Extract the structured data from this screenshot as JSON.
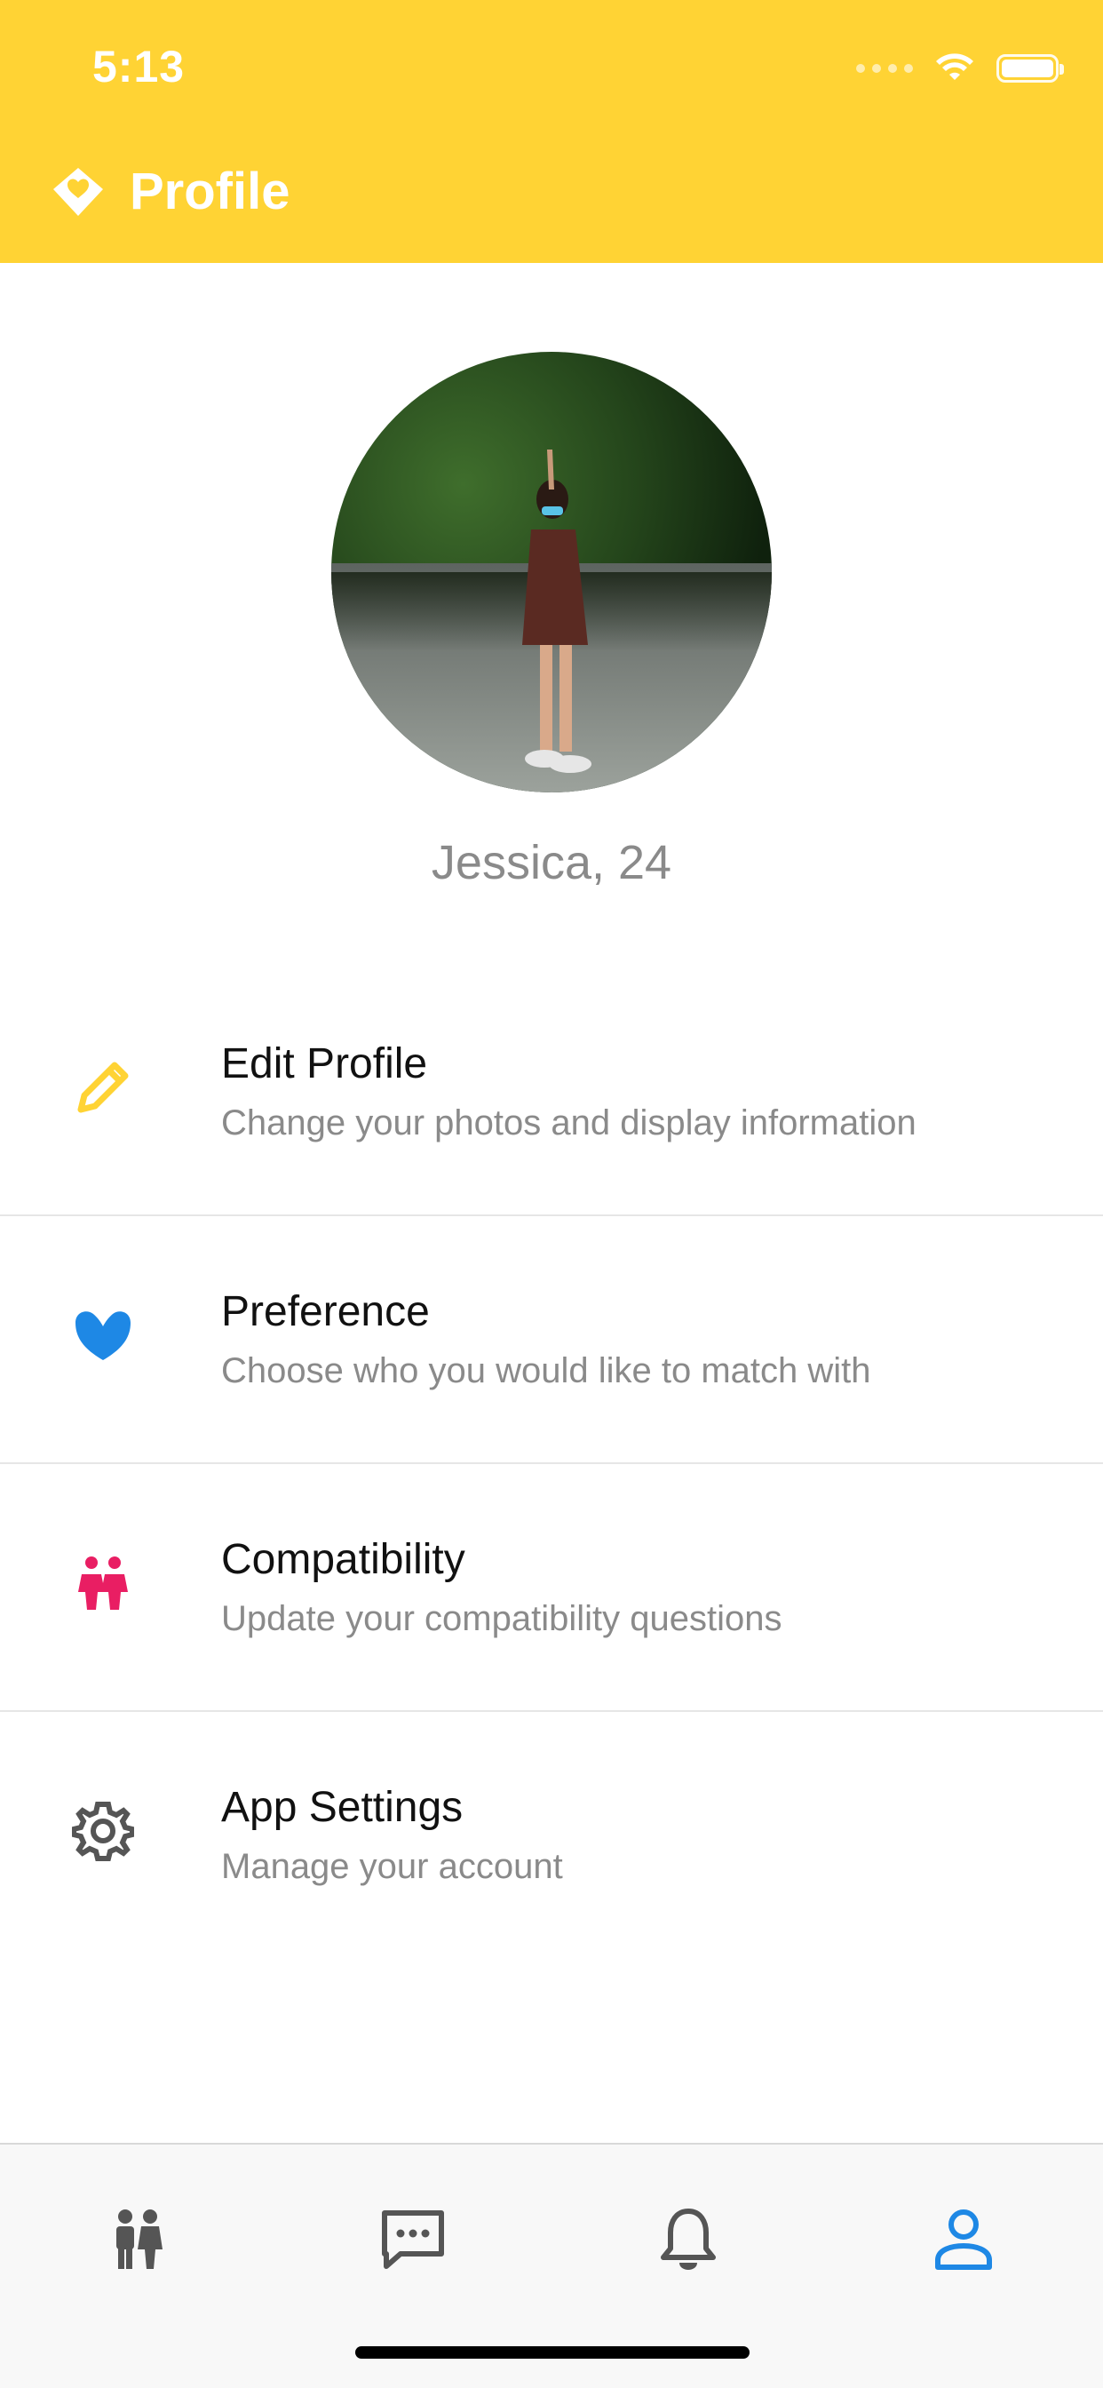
{
  "status_bar": {
    "time": "5:13"
  },
  "header": {
    "title": "Profile",
    "accent": "#FFD334"
  },
  "profile": {
    "name": "Jessica, 24"
  },
  "menu": [
    {
      "title": "Edit Profile",
      "subtitle": "Change your photos and display information",
      "icon": "pencil-icon",
      "color": "#FFD334"
    },
    {
      "title": "Preference",
      "subtitle": "Choose who you would like to match with",
      "icon": "heart-icon",
      "color": "#1E88E5"
    },
    {
      "title": "Compatibility",
      "subtitle": "Update your compatibility questions",
      "icon": "couple-icon",
      "color": "#E91E63"
    },
    {
      "title": "App Settings",
      "subtitle": "Manage your account",
      "icon": "gear-icon",
      "color": "#555555"
    }
  ],
  "tabbar": {
    "tabs": [
      {
        "icon": "people-icon"
      },
      {
        "icon": "chat-icon"
      },
      {
        "icon": "bell-icon"
      },
      {
        "icon": "profile-icon",
        "active": true
      }
    ],
    "active_color": "#1E88E5",
    "inactive_color": "#555555"
  }
}
